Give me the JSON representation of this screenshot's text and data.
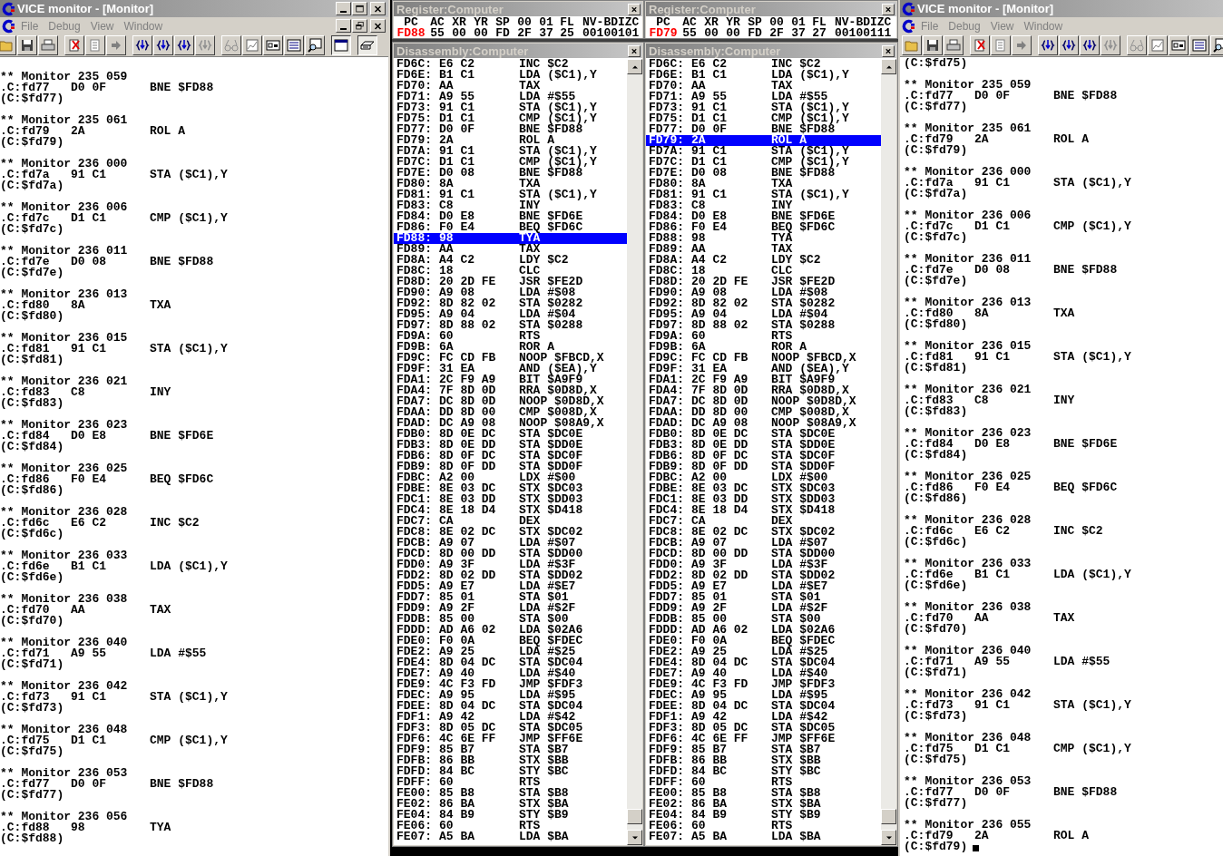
{
  "monitor_window_1": {
    "title": "VICE monitor - [Monitor]",
    "menu": [
      "File",
      "Debug",
      "View",
      "Window"
    ],
    "toolbar": [
      {
        "kind": "open",
        "pressed": false
      },
      {
        "kind": "save",
        "pressed": false
      },
      {
        "kind": "print",
        "pressed": false
      },
      {
        "kind": "separator"
      },
      {
        "kind": "clear",
        "pressed": false
      },
      {
        "kind": "lines",
        "pressed": false
      },
      {
        "kind": "arrow",
        "pressed": false
      },
      {
        "kind": "separator"
      },
      {
        "kind": "braces",
        "pressed": false
      },
      {
        "kind": "braces",
        "pressed": false
      },
      {
        "kind": "braces",
        "pressed": false
      },
      {
        "kind": "braces_grey",
        "pressed": false
      },
      {
        "kind": "separator"
      },
      {
        "kind": "glasses",
        "pressed": false
      },
      {
        "kind": "chart",
        "pressed": false
      },
      {
        "kind": "box",
        "pressed": false
      },
      {
        "kind": "list",
        "pressed": false
      },
      {
        "kind": "magnifier",
        "pressed": false
      },
      {
        "kind": "separator"
      },
      {
        "kind": "window",
        "pressed": true
      },
      {
        "kind": "separator"
      },
      {
        "kind": "keyboard",
        "pressed": true
      }
    ],
    "log": [
      {
        "header": "** Monitor 235 059",
        "address": ".C:fd77",
        "bytes": "D0 0F",
        "instruction": "BNE $FD88",
        "result": "(C:$fd77)"
      },
      {
        "header": "** Monitor 235 061",
        "address": ".C:fd79",
        "bytes": "2A",
        "instruction": "ROL A",
        "result": "(C:$fd79)"
      },
      {
        "header": "** Monitor 236 000",
        "address": ".C:fd7a",
        "bytes": "91 C1",
        "instruction": "STA ($C1),Y",
        "result": "(C:$fd7a)"
      },
      {
        "header": "** Monitor 236 006",
        "address": ".C:fd7c",
        "bytes": "D1 C1",
        "instruction": "CMP ($C1),Y",
        "result": "(C:$fd7c)"
      },
      {
        "header": "** Monitor 236 011",
        "address": ".C:fd7e",
        "bytes": "D0 08",
        "instruction": "BNE $FD88",
        "result": "(C:$fd7e)"
      },
      {
        "header": "** Monitor 236 013",
        "address": ".C:fd80",
        "bytes": "8A",
        "instruction": "TXA",
        "result": "(C:$fd80)"
      },
      {
        "header": "** Monitor 236 015",
        "address": ".C:fd81",
        "bytes": "91 C1",
        "instruction": "STA ($C1),Y",
        "result": "(C:$fd81)"
      },
      {
        "header": "** Monitor 236 021",
        "address": ".C:fd83",
        "bytes": "C8",
        "instruction": "INY",
        "result": "(C:$fd83)"
      },
      {
        "header": "** Monitor 236 023",
        "address": ".C:fd84",
        "bytes": "D0 E8",
        "instruction": "BNE $FD6E",
        "result": "(C:$fd84)"
      },
      {
        "header": "** Monitor 236 025",
        "address": ".C:fd86",
        "bytes": "F0 E4",
        "instruction": "BEQ $FD6C",
        "result": "(C:$fd86)"
      },
      {
        "header": "** Monitor 236 028",
        "address": ".C:fd6c",
        "bytes": "E6 C2",
        "instruction": "INC $C2",
        "result": "(C:$fd6c)"
      },
      {
        "header": "** Monitor 236 033",
        "address": ".C:fd6e",
        "bytes": "B1 C1",
        "instruction": "LDA ($C1),Y",
        "result": "(C:$fd6e)"
      },
      {
        "header": "** Monitor 236 038",
        "address": ".C:fd70",
        "bytes": "AA",
        "instruction": "TAX",
        "result": "(C:$fd70)"
      },
      {
        "header": "** Monitor 236 040",
        "address": ".C:fd71",
        "bytes": "A9 55",
        "instruction": "LDA #$55",
        "result": "(C:$fd71)"
      },
      {
        "header": "** Monitor 236 042",
        "address": ".C:fd73",
        "bytes": "91 C1",
        "instruction": "STA ($C1),Y",
        "result": "(C:$fd73)"
      },
      {
        "header": "** Monitor 236 048",
        "address": ".C:fd75",
        "bytes": "D1 C1",
        "instruction": "CMP ($C1),Y",
        "result": "(C:$fd75)"
      },
      {
        "header": "** Monitor 236 053",
        "address": ".C:fd77",
        "bytes": "D0 0F",
        "instruction": "BNE $FD88",
        "result": "(C:$fd77)"
      },
      {
        "header": "** Monitor 236 056",
        "address": ".C:fd88",
        "bytes": "98",
        "instruction": "TYA",
        "result": "(C:$fd88)"
      }
    ]
  },
  "register_panel_1": {
    "title": "Register:Computer",
    "registers": [
      {
        "label": "PC",
        "value": "FD88",
        "changed": true
      },
      {
        "label": "AC",
        "value": "55",
        "changed": false
      },
      {
        "label": "XR",
        "value": "00",
        "changed": false
      },
      {
        "label": "YR",
        "value": "00",
        "changed": false
      },
      {
        "label": "SP",
        "value": "FD",
        "changed": false
      },
      {
        "label": "00",
        "value": "2F",
        "changed": false
      },
      {
        "label": "01",
        "value": "37",
        "changed": false
      },
      {
        "label": "FL",
        "value": "25",
        "changed": false
      },
      {
        "label": "NV-BDIZC",
        "value": "00100101",
        "changed": false
      }
    ]
  },
  "disassembly_panel_1": {
    "title": "Disassembly:Computer",
    "rows": [
      {
        "address": "FD6C:",
        "bytes": "E6 C2",
        "instruction": "INC $C2",
        "selected": false
      },
      {
        "address": "FD6E:",
        "bytes": "B1 C1",
        "instruction": "LDA ($C1),Y",
        "selected": false
      },
      {
        "address": "FD70:",
        "bytes": "AA",
        "instruction": "TAX",
        "selected": false
      },
      {
        "address": "FD71:",
        "bytes": "A9 55",
        "instruction": "LDA #$55",
        "selected": false
      },
      {
        "address": "FD73:",
        "bytes": "91 C1",
        "instruction": "STA ($C1),Y",
        "selected": false
      },
      {
        "address": "FD75:",
        "bytes": "D1 C1",
        "instruction": "CMP ($C1),Y",
        "selected": false
      },
      {
        "address": "FD77:",
        "bytes": "D0 0F",
        "instruction": "BNE $FD88",
        "selected": false
      },
      {
        "address": "FD79:",
        "bytes": "2A",
        "instruction": "ROL A",
        "selected": false
      },
      {
        "address": "FD7A:",
        "bytes": "91 C1",
        "instruction": "STA ($C1),Y",
        "selected": false
      },
      {
        "address": "FD7C:",
        "bytes": "D1 C1",
        "instruction": "CMP ($C1),Y",
        "selected": false
      },
      {
        "address": "FD7E:",
        "bytes": "D0 08",
        "instruction": "BNE $FD88",
        "selected": false
      },
      {
        "address": "FD80:",
        "bytes": "8A",
        "instruction": "TXA",
        "selected": false
      },
      {
        "address": "FD81:",
        "bytes": "91 C1",
        "instruction": "STA ($C1),Y",
        "selected": false
      },
      {
        "address": "FD83:",
        "bytes": "C8",
        "instruction": "INY",
        "selected": false
      },
      {
        "address": "FD84:",
        "bytes": "D0 E8",
        "instruction": "BNE $FD6E",
        "selected": false
      },
      {
        "address": "FD86:",
        "bytes": "F0 E4",
        "instruction": "BEQ $FD6C",
        "selected": false
      },
      {
        "address": "FD88:",
        "bytes": "98",
        "instruction": "TYA",
        "selected": true
      },
      {
        "address": "FD89:",
        "bytes": "AA",
        "instruction": "TAX",
        "selected": false
      },
      {
        "address": "FD8A:",
        "bytes": "A4 C2",
        "instruction": "LDY $C2",
        "selected": false
      },
      {
        "address": "FD8C:",
        "bytes": "18",
        "instruction": "CLC",
        "selected": false
      },
      {
        "address": "FD8D:",
        "bytes": "20 2D FE",
        "instruction": "JSR $FE2D",
        "selected": false
      },
      {
        "address": "FD90:",
        "bytes": "A9 08",
        "instruction": "LDA #$08",
        "selected": false
      },
      {
        "address": "FD92:",
        "bytes": "8D 82 02",
        "instruction": "STA $0282",
        "selected": false
      },
      {
        "address": "FD95:",
        "bytes": "A9 04",
        "instruction": "LDA #$04",
        "selected": false
      },
      {
        "address": "FD97:",
        "bytes": "8D 88 02",
        "instruction": "STA $0288",
        "selected": false
      },
      {
        "address": "FD9A:",
        "bytes": "60",
        "instruction": "RTS",
        "selected": false
      },
      {
        "address": "FD9B:",
        "bytes": "6A",
        "instruction": "ROR A",
        "selected": false
      },
      {
        "address": "FD9C:",
        "bytes": "FC CD FB",
        "instruction": "NOOP $FBCD,X",
        "selected": false
      },
      {
        "address": "FD9F:",
        "bytes": "31 EA",
        "instruction": "AND ($EA),Y",
        "selected": false
      },
      {
        "address": "FDA1:",
        "bytes": "2C F9 A9",
        "instruction": "BIT $A9F9",
        "selected": false
      },
      {
        "address": "FDA4:",
        "bytes": "7F 8D 0D",
        "instruction": "RRA $0D8D,X",
        "selected": false
      },
      {
        "address": "FDA7:",
        "bytes": "DC 8D 0D",
        "instruction": "NOOP $0D8D,X",
        "selected": false
      },
      {
        "address": "FDAA:",
        "bytes": "DD 8D 00",
        "instruction": "CMP $008D,X",
        "selected": false
      },
      {
        "address": "FDAD:",
        "bytes": "DC A9 08",
        "instruction": "NOOP $08A9,X",
        "selected": false
      },
      {
        "address": "FDB0:",
        "bytes": "8D 0E DC",
        "instruction": "STA $DC0E",
        "selected": false
      },
      {
        "address": "FDB3:",
        "bytes": "8D 0E DD",
        "instruction": "STA $DD0E",
        "selected": false
      },
      {
        "address": "FDB6:",
        "bytes": "8D 0F DC",
        "instruction": "STA $DC0F",
        "selected": false
      },
      {
        "address": "FDB9:",
        "bytes": "8D 0F DD",
        "instruction": "STA $DD0F",
        "selected": false
      },
      {
        "address": "FDBC:",
        "bytes": "A2 00",
        "instruction": "LDX #$00",
        "selected": false
      },
      {
        "address": "FDBE:",
        "bytes": "8E 03 DC",
        "instruction": "STX $DC03",
        "selected": false
      },
      {
        "address": "FDC1:",
        "bytes": "8E 03 DD",
        "instruction": "STX $DD03",
        "selected": false
      },
      {
        "address": "FDC4:",
        "bytes": "8E 18 D4",
        "instruction": "STX $D418",
        "selected": false
      },
      {
        "address": "FDC7:",
        "bytes": "CA",
        "instruction": "DEX",
        "selected": false
      },
      {
        "address": "FDC8:",
        "bytes": "8E 02 DC",
        "instruction": "STX $DC02",
        "selected": false
      },
      {
        "address": "FDCB:",
        "bytes": "A9 07",
        "instruction": "LDA #$07",
        "selected": false
      },
      {
        "address": "FDCD:",
        "bytes": "8D 00 DD",
        "instruction": "STA $DD00",
        "selected": false
      },
      {
        "address": "FDD0:",
        "bytes": "A9 3F",
        "instruction": "LDA #$3F",
        "selected": false
      },
      {
        "address": "FDD2:",
        "bytes": "8D 02 DD",
        "instruction": "STA $DD02",
        "selected": false
      },
      {
        "address": "FDD5:",
        "bytes": "A9 E7",
        "instruction": "LDA #$E7",
        "selected": false
      },
      {
        "address": "FDD7:",
        "bytes": "85 01",
        "instruction": "STA $01",
        "selected": false
      },
      {
        "address": "FDD9:",
        "bytes": "A9 2F",
        "instruction": "LDA #$2F",
        "selected": false
      },
      {
        "address": "FDDB:",
        "bytes": "85 00",
        "instruction": "STA $00",
        "selected": false
      },
      {
        "address": "FDDD:",
        "bytes": "AD A6 02",
        "instruction": "LDA $02A6",
        "selected": false
      },
      {
        "address": "FDE0:",
        "bytes": "F0 0A",
        "instruction": "BEQ $FDEC",
        "selected": false
      },
      {
        "address": "FDE2:",
        "bytes": "A9 25",
        "instruction": "LDA #$25",
        "selected": false
      },
      {
        "address": "FDE4:",
        "bytes": "8D 04 DC",
        "instruction": "STA $DC04",
        "selected": false
      },
      {
        "address": "FDE7:",
        "bytes": "A9 40",
        "instruction": "LDA #$40",
        "selected": false
      },
      {
        "address": "FDE9:",
        "bytes": "4C F3 FD",
        "instruction": "JMP $FDF3",
        "selected": false
      },
      {
        "address": "FDEC:",
        "bytes": "A9 95",
        "instruction": "LDA #$95",
        "selected": false
      },
      {
        "address": "FDEE:",
        "bytes": "8D 04 DC",
        "instruction": "STA $DC04",
        "selected": false
      },
      {
        "address": "FDF1:",
        "bytes": "A9 42",
        "instruction": "LDA #$42",
        "selected": false
      },
      {
        "address": "FDF3:",
        "bytes": "8D 05 DC",
        "instruction": "STA $DC05",
        "selected": false
      },
      {
        "address": "FDF6:",
        "bytes": "4C 6E FF",
        "instruction": "JMP $FF6E",
        "selected": false
      },
      {
        "address": "FDF9:",
        "bytes": "85 B7",
        "instruction": "STA $B7",
        "selected": false
      },
      {
        "address": "FDFB:",
        "bytes": "86 BB",
        "instruction": "STX $BB",
        "selected": false
      },
      {
        "address": "FDFD:",
        "bytes": "84 BC",
        "instruction": "STY $BC",
        "selected": false
      },
      {
        "address": "FDFF:",
        "bytes": "60",
        "instruction": "RTS",
        "selected": false
      },
      {
        "address": "FE00:",
        "bytes": "85 B8",
        "instruction": "STA $B8",
        "selected": false
      },
      {
        "address": "FE02:",
        "bytes": "86 BA",
        "instruction": "STX $BA",
        "selected": false
      },
      {
        "address": "FE04:",
        "bytes": "84 B9",
        "instruction": "STY $B9",
        "selected": false
      },
      {
        "address": "FE06:",
        "bytes": "60",
        "instruction": "RTS",
        "selected": false
      },
      {
        "address": "FE07:",
        "bytes": "A5 BA",
        "instruction": "LDA $BA",
        "selected": false
      }
    ]
  },
  "register_panel_2": {
    "title": "Register:Computer",
    "registers": [
      {
        "label": "PC",
        "value": "FD79",
        "changed": true
      },
      {
        "label": "AC",
        "value": "55",
        "changed": false
      },
      {
        "label": "XR",
        "value": "00",
        "changed": false
      },
      {
        "label": "YR",
        "value": "00",
        "changed": false
      },
      {
        "label": "SP",
        "value": "FD",
        "changed": false
      },
      {
        "label": "00",
        "value": "2F",
        "changed": false
      },
      {
        "label": "01",
        "value": "37",
        "changed": false
      },
      {
        "label": "FL",
        "value": "27",
        "changed": false
      },
      {
        "label": "NV-BDIZC",
        "value": "00100111",
        "changed": false
      }
    ]
  },
  "disassembly_panel_2": {
    "title": "Disassembly:Computer",
    "rows": [
      {
        "address": "FD6C:",
        "bytes": "E6 C2",
        "instruction": "INC $C2",
        "selected": false
      },
      {
        "address": "FD6E:",
        "bytes": "B1 C1",
        "instruction": "LDA ($C1),Y",
        "selected": false
      },
      {
        "address": "FD70:",
        "bytes": "AA",
        "instruction": "TAX",
        "selected": false
      },
      {
        "address": "FD71:",
        "bytes": "A9 55",
        "instruction": "LDA #$55",
        "selected": false
      },
      {
        "address": "FD73:",
        "bytes": "91 C1",
        "instruction": "STA ($C1),Y",
        "selected": false
      },
      {
        "address": "FD75:",
        "bytes": "D1 C1",
        "instruction": "CMP ($C1),Y",
        "selected": false
      },
      {
        "address": "FD77:",
        "bytes": "D0 0F",
        "instruction": "BNE $FD88",
        "selected": false
      },
      {
        "address": "FD79:",
        "bytes": "2A",
        "instruction": "ROL A",
        "selected": true
      },
      {
        "address": "FD7A:",
        "bytes": "91 C1",
        "instruction": "STA ($C1),Y",
        "selected": false
      },
      {
        "address": "FD7C:",
        "bytes": "D1 C1",
        "instruction": "CMP ($C1),Y",
        "selected": false
      },
      {
        "address": "FD7E:",
        "bytes": "D0 08",
        "instruction": "BNE $FD88",
        "selected": false
      },
      {
        "address": "FD80:",
        "bytes": "8A",
        "instruction": "TXA",
        "selected": false
      },
      {
        "address": "FD81:",
        "bytes": "91 C1",
        "instruction": "STA ($C1),Y",
        "selected": false
      },
      {
        "address": "FD83:",
        "bytes": "C8",
        "instruction": "INY",
        "selected": false
      },
      {
        "address": "FD84:",
        "bytes": "D0 E8",
        "instruction": "BNE $FD6E",
        "selected": false
      },
      {
        "address": "FD86:",
        "bytes": "F0 E4",
        "instruction": "BEQ $FD6C",
        "selected": false
      },
      {
        "address": "FD88:",
        "bytes": "98",
        "instruction": "TYA",
        "selected": false
      },
      {
        "address": "FD89:",
        "bytes": "AA",
        "instruction": "TAX",
        "selected": false
      },
      {
        "address": "FD8A:",
        "bytes": "A4 C2",
        "instruction": "LDY $C2",
        "selected": false
      },
      {
        "address": "FD8C:",
        "bytes": "18",
        "instruction": "CLC",
        "selected": false
      },
      {
        "address": "FD8D:",
        "bytes": "20 2D FE",
        "instruction": "JSR $FE2D",
        "selected": false
      },
      {
        "address": "FD90:",
        "bytes": "A9 08",
        "instruction": "LDA #$08",
        "selected": false
      },
      {
        "address": "FD92:",
        "bytes": "8D 82 02",
        "instruction": "STA $0282",
        "selected": false
      },
      {
        "address": "FD95:",
        "bytes": "A9 04",
        "instruction": "LDA #$04",
        "selected": false
      },
      {
        "address": "FD97:",
        "bytes": "8D 88 02",
        "instruction": "STA $0288",
        "selected": false
      },
      {
        "address": "FD9A:",
        "bytes": "60",
        "instruction": "RTS",
        "selected": false
      },
      {
        "address": "FD9B:",
        "bytes": "6A",
        "instruction": "ROR A",
        "selected": false
      },
      {
        "address": "FD9C:",
        "bytes": "FC CD FB",
        "instruction": "NOOP $FBCD,X",
        "selected": false
      },
      {
        "address": "FD9F:",
        "bytes": "31 EA",
        "instruction": "AND ($EA),Y",
        "selected": false
      },
      {
        "address": "FDA1:",
        "bytes": "2C F9 A9",
        "instruction": "BIT $A9F9",
        "selected": false
      },
      {
        "address": "FDA4:",
        "bytes": "7F 8D 0D",
        "instruction": "RRA $0D8D,X",
        "selected": false
      },
      {
        "address": "FDA7:",
        "bytes": "DC 8D 0D",
        "instruction": "NOOP $0D8D,X",
        "selected": false
      },
      {
        "address": "FDAA:",
        "bytes": "DD 8D 00",
        "instruction": "CMP $008D,X",
        "selected": false
      },
      {
        "address": "FDAD:",
        "bytes": "DC A9 08",
        "instruction": "NOOP $08A9,X",
        "selected": false
      },
      {
        "address": "FDB0:",
        "bytes": "8D 0E DC",
        "instruction": "STA $DC0E",
        "selected": false
      },
      {
        "address": "FDB3:",
        "bytes": "8D 0E DD",
        "instruction": "STA $DD0E",
        "selected": false
      },
      {
        "address": "FDB6:",
        "bytes": "8D 0F DC",
        "instruction": "STA $DC0F",
        "selected": false
      },
      {
        "address": "FDB9:",
        "bytes": "8D 0F DD",
        "instruction": "STA $DD0F",
        "selected": false
      },
      {
        "address": "FDBC:",
        "bytes": "A2 00",
        "instruction": "LDX #$00",
        "selected": false
      },
      {
        "address": "FDBE:",
        "bytes": "8E 03 DC",
        "instruction": "STX $DC03",
        "selected": false
      },
      {
        "address": "FDC1:",
        "bytes": "8E 03 DD",
        "instruction": "STX $DD03",
        "selected": false
      },
      {
        "address": "FDC4:",
        "bytes": "8E 18 D4",
        "instruction": "STX $D418",
        "selected": false
      },
      {
        "address": "FDC7:",
        "bytes": "CA",
        "instruction": "DEX",
        "selected": false
      },
      {
        "address": "FDC8:",
        "bytes": "8E 02 DC",
        "instruction": "STX $DC02",
        "selected": false
      },
      {
        "address": "FDCB:",
        "bytes": "A9 07",
        "instruction": "LDA #$07",
        "selected": false
      },
      {
        "address": "FDCD:",
        "bytes": "8D 00 DD",
        "instruction": "STA $DD00",
        "selected": false
      },
      {
        "address": "FDD0:",
        "bytes": "A9 3F",
        "instruction": "LDA #$3F",
        "selected": false
      },
      {
        "address": "FDD2:",
        "bytes": "8D 02 DD",
        "instruction": "STA $DD02",
        "selected": false
      },
      {
        "address": "FDD5:",
        "bytes": "A9 E7",
        "instruction": "LDA #$E7",
        "selected": false
      },
      {
        "address": "FDD7:",
        "bytes": "85 01",
        "instruction": "STA $01",
        "selected": false
      },
      {
        "address": "FDD9:",
        "bytes": "A9 2F",
        "instruction": "LDA #$2F",
        "selected": false
      },
      {
        "address": "FDDB:",
        "bytes": "85 00",
        "instruction": "STA $00",
        "selected": false
      },
      {
        "address": "FDDD:",
        "bytes": "AD A6 02",
        "instruction": "LDA $02A6",
        "selected": false
      },
      {
        "address": "FDE0:",
        "bytes": "F0 0A",
        "instruction": "BEQ $FDEC",
        "selected": false
      },
      {
        "address": "FDE2:",
        "bytes": "A9 25",
        "instruction": "LDA #$25",
        "selected": false
      },
      {
        "address": "FDE4:",
        "bytes": "8D 04 DC",
        "instruction": "STA $DC04",
        "selected": false
      },
      {
        "address": "FDE7:",
        "bytes": "A9 40",
        "instruction": "LDA #$40",
        "selected": false
      },
      {
        "address": "FDE9:",
        "bytes": "4C F3 FD",
        "instruction": "JMP $FDF3",
        "selected": false
      },
      {
        "address": "FDEC:",
        "bytes": "A9 95",
        "instruction": "LDA #$95",
        "selected": false
      },
      {
        "address": "FDEE:",
        "bytes": "8D 04 DC",
        "instruction": "STA $DC04",
        "selected": false
      },
      {
        "address": "FDF1:",
        "bytes": "A9 42",
        "instruction": "LDA #$42",
        "selected": false
      },
      {
        "address": "FDF3:",
        "bytes": "8D 05 DC",
        "instruction": "STA $DC05",
        "selected": false
      },
      {
        "address": "FDF6:",
        "bytes": "4C 6E FF",
        "instruction": "JMP $FF6E",
        "selected": false
      },
      {
        "address": "FDF9:",
        "bytes": "85 B7",
        "instruction": "STA $B7",
        "selected": false
      },
      {
        "address": "FDFB:",
        "bytes": "86 BB",
        "instruction": "STX $BB",
        "selected": false
      },
      {
        "address": "FDFD:",
        "bytes": "84 BC",
        "instruction": "STY $BC",
        "selected": false
      },
      {
        "address": "FDFF:",
        "bytes": "60",
        "instruction": "RTS",
        "selected": false
      },
      {
        "address": "FE00:",
        "bytes": "85 B8",
        "instruction": "STA $B8",
        "selected": false
      },
      {
        "address": "FE02:",
        "bytes": "86 BA",
        "instruction": "STX $BA",
        "selected": false
      },
      {
        "address": "FE04:",
        "bytes": "84 B9",
        "instruction": "STY $B9",
        "selected": false
      },
      {
        "address": "FE06:",
        "bytes": "60",
        "instruction": "RTS",
        "selected": false
      },
      {
        "address": "FE07:",
        "bytes": "A5 BA",
        "instruction": "LDA $BA",
        "selected": false
      }
    ]
  },
  "monitor_window_2": {
    "title": "VICE monitor - [Monitor]",
    "menu": [
      "File",
      "Debug",
      "View",
      "Window"
    ],
    "toolbar": [
      {
        "kind": "open",
        "pressed": false
      },
      {
        "kind": "save",
        "pressed": false
      },
      {
        "kind": "print",
        "pressed": false
      },
      {
        "kind": "separator"
      },
      {
        "kind": "clear",
        "pressed": false
      },
      {
        "kind": "lines",
        "pressed": false
      },
      {
        "kind": "arrow",
        "pressed": false
      },
      {
        "kind": "separator"
      },
      {
        "kind": "braces",
        "pressed": false
      },
      {
        "kind": "braces",
        "pressed": false
      },
      {
        "kind": "braces",
        "pressed": false
      },
      {
        "kind": "braces_grey",
        "pressed": false
      },
      {
        "kind": "separator"
      },
      {
        "kind": "glasses",
        "pressed": false
      },
      {
        "kind": "chart",
        "pressed": false
      },
      {
        "kind": "box",
        "pressed": false
      },
      {
        "kind": "list",
        "pressed": false
      },
      {
        "kind": "magnifier",
        "pressed": false
      }
    ],
    "first_line": "(C:$fd75)",
    "log": [
      {
        "header": "** Monitor 235 059",
        "address": ".C:fd77",
        "bytes": "D0 0F",
        "instruction": "BNE $FD88",
        "result": "(C:$fd77)"
      },
      {
        "header": "** Monitor 235 061",
        "address": ".C:fd79",
        "bytes": "2A",
        "instruction": "ROL A",
        "result": "(C:$fd79)"
      },
      {
        "header": "** Monitor 236 000",
        "address": ".C:fd7a",
        "bytes": "91 C1",
        "instruction": "STA ($C1),Y",
        "result": "(C:$fd7a)"
      },
      {
        "header": "** Monitor 236 006",
        "address": ".C:fd7c",
        "bytes": "D1 C1",
        "instruction": "CMP ($C1),Y",
        "result": "(C:$fd7c)"
      },
      {
        "header": "** Monitor 236 011",
        "address": ".C:fd7e",
        "bytes": "D0 08",
        "instruction": "BNE $FD88",
        "result": "(C:$fd7e)"
      },
      {
        "header": "** Monitor 236 013",
        "address": ".C:fd80",
        "bytes": "8A",
        "instruction": "TXA",
        "result": "(C:$fd80)"
      },
      {
        "header": "** Monitor 236 015",
        "address": ".C:fd81",
        "bytes": "91 C1",
        "instruction": "STA ($C1),Y",
        "result": "(C:$fd81)"
      },
      {
        "header": "** Monitor 236 021",
        "address": ".C:fd83",
        "bytes": "C8",
        "instruction": "INY",
        "result": "(C:$fd83)"
      },
      {
        "header": "** Monitor 236 023",
        "address": ".C:fd84",
        "bytes": "D0 E8",
        "instruction": "BNE $FD6E",
        "result": "(C:$fd84)"
      },
      {
        "header": "** Monitor 236 025",
        "address": ".C:fd86",
        "bytes": "F0 E4",
        "instruction": "BEQ $FD6C",
        "result": "(C:$fd86)"
      },
      {
        "header": "** Monitor 236 028",
        "address": ".C:fd6c",
        "bytes": "E6 C2",
        "instruction": "INC $C2",
        "result": "(C:$fd6c)"
      },
      {
        "header": "** Monitor 236 033",
        "address": ".C:fd6e",
        "bytes": "B1 C1",
        "instruction": "LDA ($C1),Y",
        "result": "(C:$fd6e)"
      },
      {
        "header": "** Monitor 236 038",
        "address": ".C:fd70",
        "bytes": "AA",
        "instruction": "TAX",
        "result": "(C:$fd70)"
      },
      {
        "header": "** Monitor 236 040",
        "address": ".C:fd71",
        "bytes": "A9 55",
        "instruction": "LDA #$55",
        "result": "(C:$fd71)"
      },
      {
        "header": "** Monitor 236 042",
        "address": ".C:fd73",
        "bytes": "91 C1",
        "instruction": "STA ($C1),Y",
        "result": "(C:$fd73)"
      },
      {
        "header": "** Monitor 236 048",
        "address": ".C:fd75",
        "bytes": "D1 C1",
        "instruction": "CMP ($C1),Y",
        "result": "(C:$fd75)"
      },
      {
        "header": "** Monitor 236 053",
        "address": ".C:fd77",
        "bytes": "D0 0F",
        "instruction": "BNE $FD88",
        "result": "(C:$fd77)"
      },
      {
        "header": "** Monitor 236 055",
        "address": ".C:fd79",
        "bytes": "2A",
        "instruction": "ROL A",
        "result": "(C:$fd79)"
      }
    ]
  }
}
